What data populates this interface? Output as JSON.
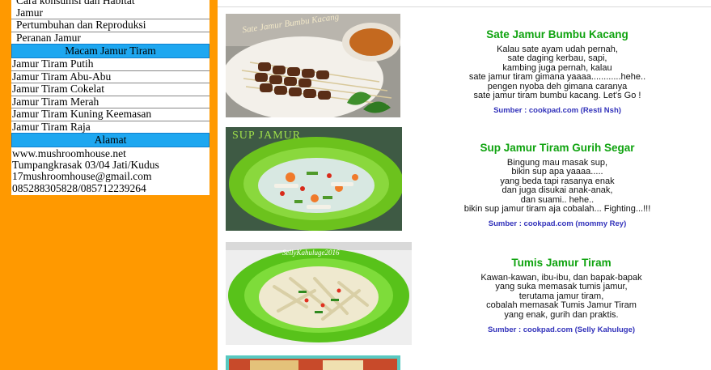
{
  "sidebar": {
    "top_items": [
      "Cara konsumsi dan Habitat",
      "Jamur",
      "Pertumbuhan dan Reproduksi",
      "Peranan Jamur"
    ],
    "section_types": "Macam Jamur Tiram",
    "types": [
      "Jamur Tiram Putih",
      "Jamur Tiram Abu-Abu",
      "Jamur Tiram Cokelat",
      "Jamur Tiram Merah",
      "Jamur Tiram Kuning Keemasan",
      "Jamur Tiram Raja"
    ],
    "section_address": "Alamat",
    "address_lines": [
      "www.mushroomhouse.net",
      "Tumpangkrasak 03/04 Jati/Kudus",
      "17mushroomhouse@gmail.com",
      "085288305828/085712239264"
    ]
  },
  "recipes": [
    {
      "title": "Sate Jamur Bumbu Kacang",
      "body": [
        "Kalau sate ayam udah pernah,",
        "sate daging kerbau, sapi,",
        "kambing juga pernah, kalau",
        "sate jamur tiram gimana yaaaa............hehe..",
        "pengen nyoba deh gimana caranya",
        "sate jamur tiram bumbu kacang. Let's Go !"
      ],
      "source": "Sumber : cookpad.com (Resti Nsh)",
      "image_caption": "Sate Jamur Bumbu Kacang"
    },
    {
      "title": "Sup Jamur Tiram Gurih Segar",
      "body": [
        "Bingung mau masak sup,",
        "bikin sup apa yaaaa.....",
        "yang beda tapi rasanya enak",
        "dan juga disukai anak-anak,",
        "dan suami.. hehe..",
        "bikin sup jamur tiram aja cobalah... Fighting...!!!"
      ],
      "source": "Sumber : cookpad.com (mommy Rey)",
      "image_caption": "SUP JAMUR"
    },
    {
      "title": "Tumis Jamur Tiram",
      "body": [
        "Kawan-kawan, ibu-ibu, dan bapak-bapak",
        "yang suka memasak tumis jamur,",
        "terutama jamur tiram,",
        "cobalah memasak Tumis Jamur Tiram",
        "yang enak, gurih dan praktis."
      ],
      "source": "Sumber : cookpad.com (Selly Kahuluge)",
      "image_caption": "SellyKahuluge2016"
    }
  ],
  "colors": {
    "sidebar_bg": "#ff9900",
    "section_head": "#1ea7f0",
    "title_green": "#0fa30f",
    "source_blue": "#3333bb"
  }
}
